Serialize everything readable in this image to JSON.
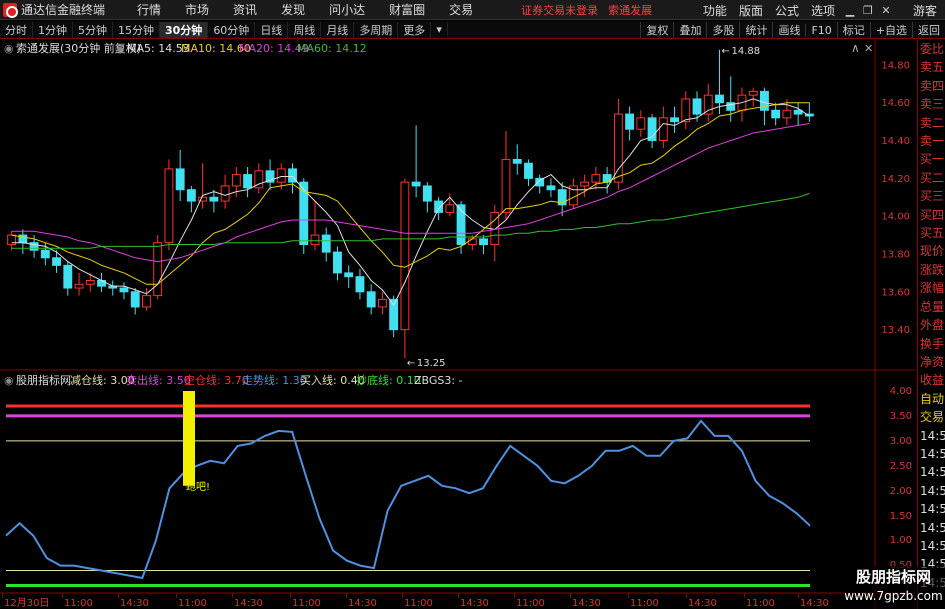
{
  "app": {
    "title": "通达信金融终端",
    "menus": [
      "行情",
      "市场",
      "资讯",
      "发现",
      "问小达",
      "财富圈",
      "交易"
    ],
    "status_left": "证券交易未登录",
    "status_right": "索通发展",
    "right_menus": [
      "功能",
      "版面",
      "公式",
      "选项"
    ],
    "guest": "游客"
  },
  "periods": [
    "分时",
    "1分钟",
    "5分钟",
    "15分钟",
    "30分钟",
    "60分钟",
    "日线",
    "周线",
    "月线",
    "多周期",
    "更多"
  ],
  "active_period": "30分钟",
  "toolbar_right": [
    "复权",
    "叠加",
    "多股",
    "统计",
    "画线",
    "F10",
    "标记",
    "+自选",
    "返回"
  ],
  "main_chart": {
    "title": "索通发展(30分钟 前复权)",
    "ma_legend": [
      {
        "label": "MA5: 14.53",
        "color": "#e0e0e0"
      },
      {
        "label": "MA10: 14.60",
        "color": "#e8d000"
      },
      {
        "label": "MA20: 14.49",
        "color": "#e040e0"
      },
      {
        "label": "MA60: 14.12",
        "color": "#30c030"
      }
    ],
    "y_labels": [
      "14.80",
      "14.60",
      "14.40",
      "14.20",
      "14.00",
      "13.80",
      "13.60",
      "13.40"
    ],
    "high_label": "14.88",
    "low_label": "13.25"
  },
  "indicator": {
    "name": "股朋指标网",
    "legend": [
      {
        "label": "减仓线: 3.00",
        "color": "#e8e0a0"
      },
      {
        "label": "卖出线: 3.50",
        "color": "#e040e0"
      },
      {
        "label": "空仓线: 3.70",
        "color": "#ff3030"
      },
      {
        "label": "走势线: 1.30",
        "color": "#5090e0"
      },
      {
        "label": "买入线: 0.40",
        "color": "#e8e0a0"
      },
      {
        "label": "抄底线: 0.10",
        "color": "#30e030"
      },
      {
        "label": "ZBGS3: -",
        "color": "#dddddd"
      }
    ],
    "y_labels": [
      "4.00",
      "3.50",
      "3.00",
      "2.50",
      "2.00",
      "1.50",
      "1.00",
      "0.50"
    ],
    "signal_text": "跑吧!"
  },
  "x_axis": [
    "12月30日",
    "11:00",
    "14:30",
    "11:00",
    "14:30",
    "11:00",
    "14:30",
    "11:00",
    "14:30",
    "11:00",
    "14:30",
    "11:00",
    "14:30",
    "11:00",
    "14:30"
  ],
  "right_panel": {
    "top": [
      "委比",
      "卖五",
      "卖四",
      "卖三",
      "卖二",
      "卖一",
      "买一",
      "买二",
      "买三",
      "买四",
      "买五",
      "现价",
      "涨跌",
      "涨幅",
      "总量",
      "外盘",
      "换手",
      "净资",
      "收益"
    ],
    "bottom_head": [
      "自动",
      "交易"
    ],
    "bottom_times": [
      "14:5",
      "14:5",
      "14:5",
      "14:5",
      "14:5",
      "14:5",
      "14:5",
      "14:5",
      "14:5"
    ]
  },
  "watermark": {
    "line1": "股朋指标网",
    "line2": "www.7gpzb.com"
  },
  "chart_data": [
    {
      "type": "candlestick",
      "title": "索通发展(30分钟 前复权)",
      "ylim": [
        13.25,
        14.9
      ],
      "y_ticks": [
        13.4,
        13.6,
        13.8,
        14.0,
        14.2,
        14.4,
        14.6,
        14.8
      ],
      "candles": [
        [
          13.85,
          13.9,
          13.82,
          13.92
        ],
        [
          13.9,
          13.86,
          13.8,
          13.93
        ],
        [
          13.86,
          13.82,
          13.78,
          13.9
        ],
        [
          13.82,
          13.78,
          13.74,
          13.86
        ],
        [
          13.78,
          13.74,
          13.7,
          13.82
        ],
        [
          13.74,
          13.62,
          13.58,
          13.76
        ],
        [
          13.62,
          13.64,
          13.58,
          13.7
        ],
        [
          13.64,
          13.66,
          13.6,
          13.7
        ],
        [
          13.66,
          13.63,
          13.6,
          13.7
        ],
        [
          13.63,
          13.62,
          13.58,
          13.66
        ],
        [
          13.62,
          13.6,
          13.56,
          13.65
        ],
        [
          13.6,
          13.52,
          13.48,
          13.62
        ],
        [
          13.52,
          13.58,
          13.5,
          13.62
        ],
        [
          13.58,
          13.86,
          13.56,
          13.9
        ],
        [
          13.86,
          14.25,
          13.82,
          14.3
        ],
        [
          14.25,
          14.14,
          14.08,
          14.35
        ],
        [
          14.14,
          14.08,
          14.02,
          14.16
        ],
        [
          14.08,
          14.1,
          14.04,
          14.28
        ],
        [
          14.1,
          14.08,
          14.02,
          14.14
        ],
        [
          14.08,
          14.16,
          14.04,
          14.22
        ],
        [
          14.16,
          14.22,
          14.1,
          14.26
        ],
        [
          14.22,
          14.15,
          14.1,
          14.26
        ],
        [
          14.15,
          14.24,
          14.12,
          14.28
        ],
        [
          14.24,
          14.18,
          14.14,
          14.3
        ],
        [
          14.18,
          14.25,
          14.14,
          14.28
        ],
        [
          14.25,
          14.18,
          14.12,
          14.28
        ],
        [
          14.18,
          13.85,
          13.8,
          14.2
        ],
        [
          13.85,
          13.9,
          13.82,
          14.08
        ],
        [
          13.9,
          13.81,
          13.76,
          13.94
        ],
        [
          13.81,
          13.7,
          13.66,
          13.84
        ],
        [
          13.7,
          13.68,
          13.62,
          13.74
        ],
        [
          13.68,
          13.6,
          13.56,
          13.72
        ],
        [
          13.6,
          13.52,
          13.48,
          13.64
        ],
        [
          13.52,
          13.56,
          13.48,
          13.6
        ],
        [
          13.56,
          13.4,
          13.36,
          13.58
        ],
        [
          13.4,
          14.18,
          13.25,
          14.2
        ],
        [
          14.18,
          14.16,
          14.1,
          14.48
        ],
        [
          14.16,
          14.08,
          14.02,
          14.18
        ],
        [
          14.08,
          14.02,
          13.98,
          14.1
        ],
        [
          14.02,
          14.06,
          14.0,
          14.12
        ],
        [
          14.06,
          13.85,
          13.8,
          14.08
        ],
        [
          13.85,
          13.88,
          13.82,
          13.9
        ],
        [
          13.88,
          13.85,
          13.8,
          13.9
        ],
        [
          13.85,
          14.02,
          13.76,
          14.06
        ],
        [
          14.02,
          14.3,
          13.98,
          14.45
        ],
        [
          14.3,
          14.28,
          14.22,
          14.38
        ],
        [
          14.28,
          14.2,
          14.16,
          14.3
        ],
        [
          14.2,
          14.16,
          14.12,
          14.22
        ],
        [
          14.16,
          14.14,
          14.1,
          14.2
        ],
        [
          14.14,
          14.06,
          14.0,
          14.18
        ],
        [
          14.06,
          14.16,
          14.04,
          14.2
        ],
        [
          14.16,
          14.18,
          14.1,
          14.22
        ],
        [
          14.18,
          14.22,
          14.14,
          14.26
        ],
        [
          14.22,
          14.18,
          14.12,
          14.26
        ],
        [
          14.18,
          14.54,
          14.14,
          14.62
        ],
        [
          14.54,
          14.46,
          14.4,
          14.58
        ],
        [
          14.46,
          14.52,
          14.42,
          14.56
        ],
        [
          14.52,
          14.4,
          14.36,
          14.54
        ],
        [
          14.4,
          14.52,
          14.36,
          14.58
        ],
        [
          14.52,
          14.5,
          14.44,
          14.58
        ],
        [
          14.5,
          14.62,
          14.46,
          14.66
        ],
        [
          14.62,
          14.54,
          14.5,
          14.66
        ],
        [
          14.54,
          14.64,
          14.5,
          14.7
        ],
        [
          14.64,
          14.6,
          14.54,
          14.88
        ],
        [
          14.6,
          14.56,
          14.5,
          14.74
        ],
        [
          14.56,
          14.64,
          14.5,
          14.68
        ],
        [
          14.64,
          14.66,
          14.58,
          14.68
        ],
        [
          14.66,
          14.56,
          14.48,
          14.68
        ],
        [
          14.56,
          14.52,
          14.48,
          14.6
        ],
        [
          14.52,
          14.56,
          14.48,
          14.62
        ],
        [
          14.56,
          14.54,
          14.48,
          14.6
        ],
        [
          14.54,
          14.53,
          14.5,
          14.6
        ]
      ],
      "series": [
        {
          "name": "MA5",
          "values": [
            13.86,
            13.86,
            13.85,
            13.84,
            13.81,
            13.76,
            13.72,
            13.69,
            13.66,
            13.63,
            13.63,
            13.61,
            13.59,
            13.64,
            13.75,
            13.87,
            13.98,
            14.11,
            14.13,
            14.11,
            14.13,
            14.14,
            14.17,
            14.19,
            14.21,
            14.21,
            14.14,
            14.08,
            14.02,
            13.95,
            13.81,
            13.74,
            13.66,
            13.61,
            13.53,
            13.65,
            13.79,
            13.92,
            14.04,
            14.1,
            14.03,
            13.98,
            13.94,
            13.93,
            13.98,
            14.06,
            14.13,
            14.19,
            14.22,
            14.16,
            14.14,
            14.14,
            14.15,
            14.15,
            14.25,
            14.32,
            14.4,
            14.42,
            14.49,
            14.48,
            14.51,
            14.52,
            14.56,
            14.58,
            14.59,
            14.6,
            14.62,
            14.6,
            14.59,
            14.59,
            14.57,
            14.53
          ]
        },
        {
          "name": "MA10",
          "values": [
            13.9,
            13.89,
            13.88,
            13.86,
            13.84,
            13.81,
            13.79,
            13.77,
            13.74,
            13.72,
            13.7,
            13.67,
            13.64,
            13.64,
            13.69,
            13.74,
            13.79,
            13.86,
            13.91,
            13.93,
            13.97,
            14.01,
            14.07,
            14.15,
            14.16,
            14.17,
            14.13,
            14.12,
            14.11,
            14.08,
            14.01,
            13.94,
            13.87,
            13.81,
            13.74,
            13.73,
            13.76,
            13.79,
            13.83,
            13.82,
            13.84,
            13.88,
            13.93,
            13.98,
            14.04,
            14.04,
            14.05,
            14.06,
            14.08,
            14.07,
            14.1,
            14.13,
            14.17,
            14.18,
            14.21,
            14.23,
            14.27,
            14.28,
            14.32,
            14.37,
            14.41,
            14.46,
            14.49,
            14.53,
            14.54,
            14.56,
            14.57,
            14.58,
            14.59,
            14.6,
            14.6,
            14.6
          ]
        },
        {
          "name": "MA20",
          "values": [
            13.92,
            13.92,
            13.92,
            13.91,
            13.9,
            13.89,
            13.87,
            13.86,
            13.84,
            13.82,
            13.8,
            13.78,
            13.77,
            13.76,
            13.77,
            13.78,
            13.8,
            13.82,
            13.84,
            13.86,
            13.89,
            13.91,
            13.93,
            13.95,
            13.97,
            13.98,
            13.98,
            13.98,
            13.98,
            13.97,
            13.96,
            13.95,
            13.94,
            13.93,
            13.92,
            13.91,
            13.91,
            13.91,
            13.91,
            13.91,
            13.91,
            13.91,
            13.92,
            13.93,
            13.94,
            13.95,
            13.96,
            13.98,
            14.0,
            14.02,
            14.04,
            14.06,
            14.08,
            14.1,
            14.13,
            14.15,
            14.18,
            14.21,
            14.24,
            14.27,
            14.3,
            14.33,
            14.36,
            14.38,
            14.4,
            14.42,
            14.44,
            14.45,
            14.46,
            14.47,
            14.48,
            14.49
          ]
        },
        {
          "name": "MA60",
          "values": [
            13.83,
            13.83,
            13.83,
            13.83,
            13.83,
            13.83,
            13.83,
            13.83,
            13.84,
            13.84,
            13.84,
            13.84,
            13.84,
            13.84,
            13.85,
            13.85,
            13.85,
            13.85,
            13.85,
            13.86,
            13.86,
            13.86,
            13.86,
            13.86,
            13.86,
            13.87,
            13.87,
            13.87,
            13.87,
            13.87,
            13.87,
            13.87,
            13.87,
            13.88,
            13.88,
            13.88,
            13.88,
            13.88,
            13.88,
            13.89,
            13.89,
            13.89,
            13.89,
            13.9,
            13.9,
            13.91,
            13.91,
            13.92,
            13.92,
            13.93,
            13.93,
            13.94,
            13.94,
            13.95,
            13.96,
            13.96,
            13.97,
            13.98,
            13.98,
            13.99,
            14.0,
            14.01,
            14.02,
            14.03,
            14.04,
            14.05,
            14.06,
            14.07,
            14.08,
            14.09,
            14.1,
            14.12
          ]
        }
      ]
    },
    {
      "type": "line",
      "title": "股朋指标网",
      "ylim": [
        0.05,
        4.0
      ],
      "y_ticks": [
        0.5,
        1.0,
        1.5,
        2.0,
        2.5,
        3.0,
        3.5,
        4.0
      ],
      "horizontal_lines": [
        {
          "name": "空仓线",
          "value": 3.7,
          "color": "#ff3030"
        },
        {
          "name": "卖出线",
          "value": 3.5,
          "color": "#e040e0"
        },
        {
          "name": "减仓线",
          "value": 3.0,
          "color": "#e8e0a0"
        },
        {
          "name": "买入线",
          "value": 0.4,
          "color": "#e8e0a0"
        },
        {
          "name": "抄底线",
          "value": 0.1,
          "color": "#30e030"
        }
      ],
      "series": [
        {
          "name": "走势线",
          "color": "#5090e0",
          "values": [
            1.1,
            1.35,
            1.1,
            0.65,
            0.5,
            0.5,
            0.45,
            0.4,
            0.35,
            0.3,
            0.25,
            1.0,
            2.05,
            2.35,
            2.5,
            2.6,
            2.55,
            2.9,
            2.95,
            3.1,
            3.2,
            3.18,
            2.3,
            1.45,
            0.8,
            0.6,
            0.5,
            0.45,
            1.6,
            2.1,
            2.2,
            2.3,
            2.1,
            2.05,
            1.95,
            2.05,
            2.5,
            2.9,
            2.7,
            2.5,
            2.2,
            2.15,
            2.3,
            2.5,
            2.8,
            2.8,
            2.9,
            2.7,
            2.7,
            3.0,
            3.05,
            3.4,
            3.1,
            3.1,
            2.8,
            2.2,
            1.9,
            1.75,
            1.55,
            1.3
          ]
        }
      ],
      "signal_bar": {
        "from": 2.1,
        "to": 4.0,
        "color": "#f0f000",
        "text": "跑吧!"
      }
    }
  ]
}
